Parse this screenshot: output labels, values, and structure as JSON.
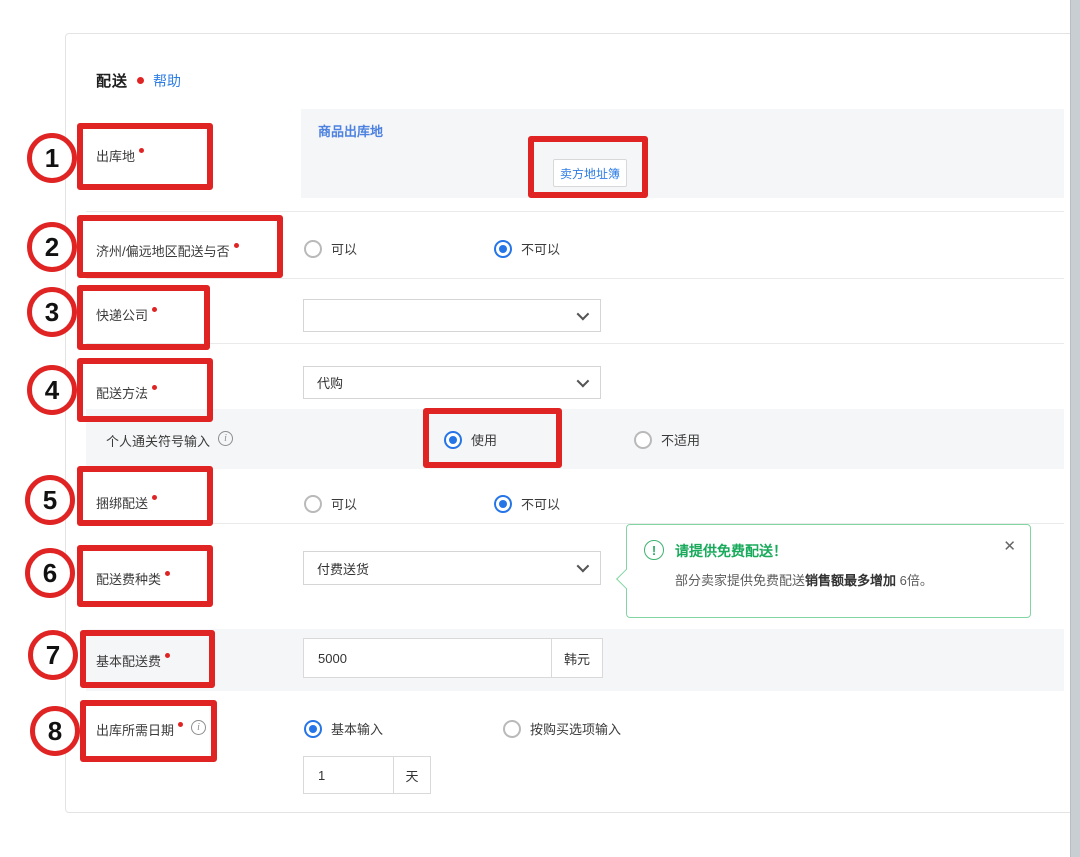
{
  "colors": {
    "annotation_red": "#e02424",
    "link_blue": "#2e7de5",
    "radio_blue": "#2575e8",
    "panel_title_blue": "#4d82e0",
    "tooltip_green": "#1aaa5c"
  },
  "header": {
    "title": "配送",
    "help": "帮助"
  },
  "rows": {
    "shipping_origin": {
      "label": "出库地",
      "panel_title": "商品出库地",
      "address_book_button": "卖方地址簿"
    },
    "jeju_remote": {
      "label": "济州/偏远地区配送与否",
      "option_yes": "可以",
      "option_no": "不可以"
    },
    "courier": {
      "label": "快递公司",
      "value": ""
    },
    "delivery_method": {
      "label": "配送方法",
      "value": "代购"
    },
    "customs_code": {
      "label": "个人通关符号输入",
      "option_use": "使用",
      "option_not_applicable": "不适用"
    },
    "bundle": {
      "label": "捆绑配送",
      "option_yes": "可以",
      "option_no": "不可以"
    },
    "fee_type": {
      "label": "配送费种类",
      "value": "付费送货"
    },
    "base_fee": {
      "label": "基本配送费",
      "value": "5000",
      "unit": "韩元"
    },
    "lead_time": {
      "label": "出库所需日期",
      "option_basic": "基本输入",
      "option_by_option": "按购买选项输入",
      "value": "1",
      "unit": "天"
    }
  },
  "tooltip": {
    "title": "请提供免费配送！",
    "body_start": "部分卖家提供免费配送",
    "body_bold": "销售额最多增加",
    "body_end": " 6倍。",
    "close": "✕"
  },
  "annotations": {
    "n1": "1",
    "n2": "2",
    "n3": "3",
    "n4": "4",
    "n5": "5",
    "n6": "6",
    "n7": "7",
    "n8": "8"
  }
}
